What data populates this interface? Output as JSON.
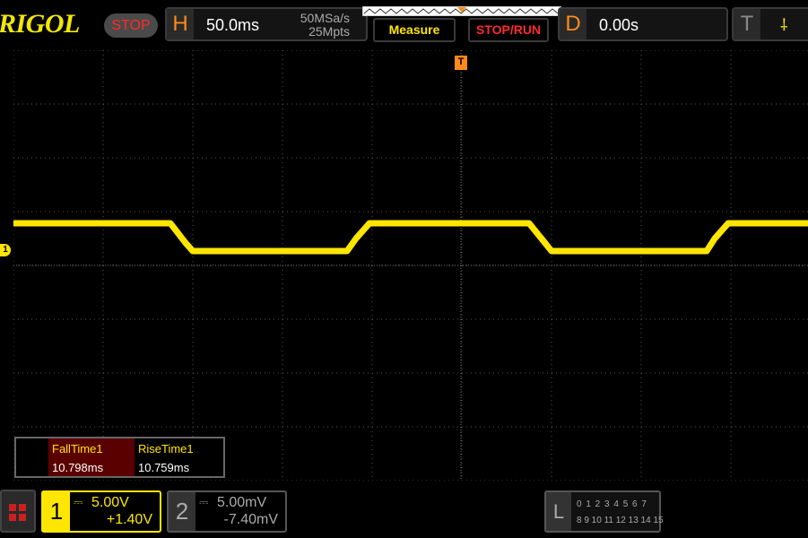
{
  "brand": "RIGOL",
  "run_state": "STOP",
  "horizontal": {
    "tag": "H",
    "timebase": "50.0ms",
    "sample_rate": "50MSa/s",
    "memory_depth": "25Mpts"
  },
  "buttons": {
    "measure": "Measure",
    "stop_run": "STOP/RUN"
  },
  "delay": {
    "tag": "D",
    "value": "0.00s"
  },
  "trigger": {
    "tag": "T",
    "symbol": "⸸",
    "marker": "T"
  },
  "channel_marker": "1",
  "measurements": [
    {
      "name": "FallTime1",
      "value": "10.798ms"
    },
    {
      "name": "RiseTime1",
      "value": "10.759ms"
    }
  ],
  "channels": [
    {
      "number": "1",
      "coupling": "⎓",
      "scale": "5.00V",
      "offset": "+1.40V"
    },
    {
      "number": "2",
      "coupling": "⎓",
      "scale": "5.00mV",
      "offset": "-7.40mV"
    }
  ],
  "logic": {
    "tag": "L",
    "row1": "0 1 2 3  4 5 6 7",
    "row2": "8 9 10 11 12 13 14 15"
  },
  "colors": {
    "ch1": "#ffe600",
    "trigger": "#ff8a1a",
    "stop": "#ff2a2a",
    "background": "#000000"
  }
}
